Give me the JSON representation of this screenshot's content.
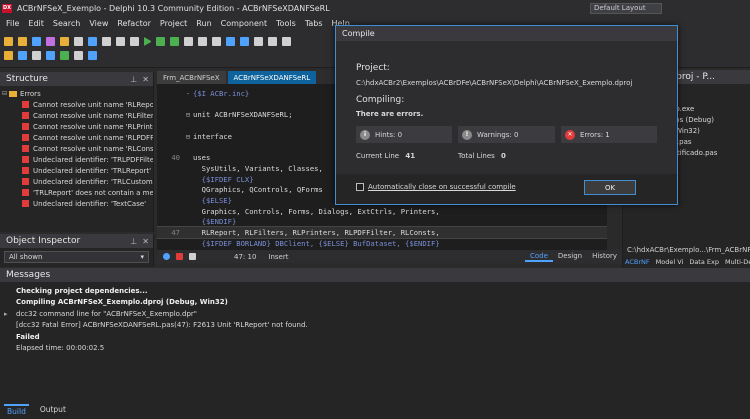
{
  "window": {
    "title": "ACBrNFSeX_Exemplo - Delphi 10.3 Community Edition - ACBrNFSeXDANFSeRL",
    "logo_text": "DX",
    "layout_label": "Default Layout"
  },
  "menu": [
    "File",
    "Edit",
    "Search",
    "View",
    "Refactor",
    "Project",
    "Run",
    "Component",
    "Tools",
    "Tabs",
    "Help"
  ],
  "structure": {
    "title": "Structure",
    "root_label": "Errors",
    "items": [
      "Cannot resolve unit name 'RLReport'",
      "Cannot resolve unit name 'RLFilters'",
      "Cannot resolve unit name 'RLPrinters'",
      "Cannot resolve unit name 'RLPDFFilter'",
      "Cannot resolve unit name 'RLConsts'",
      "Undeclared identifier: 'TRLPDFFilter' at",
      "Undeclared identifier: 'TRLReport' at",
      "Undeclared identifier: 'TRLCustomReport'",
      "'TRLReport' does not contain a member",
      "Undeclared identifier: 'TextCase'"
    ]
  },
  "object_inspector": {
    "title": "Object Inspector",
    "combo_value": "All shown"
  },
  "editor": {
    "tabs": [
      {
        "label": "Frm_ACBrNFSeX",
        "active": false
      },
      {
        "label": "ACBrNFSeXDANFSeRL",
        "active": true
      }
    ],
    "lines": [
      {
        "num": "",
        "fold": "-",
        "text": "{$I ACBr.inc}",
        "kind": "dir"
      },
      {
        "num": "",
        "fold": "",
        "text": "",
        "kind": "code"
      },
      {
        "num": "",
        "fold": "⊟",
        "text": "unit ACBrNFSeXDANFSeRL;",
        "kind": "code"
      },
      {
        "num": "",
        "fold": "",
        "text": "",
        "kind": "code"
      },
      {
        "num": "",
        "fold": "⊟",
        "text": "interface",
        "kind": "code"
      },
      {
        "num": "",
        "fold": "",
        "text": "",
        "kind": "code"
      },
      {
        "num": "40",
        "fold": "",
        "text": "uses",
        "kind": "code"
      },
      {
        "num": "",
        "fold": "",
        "text": "  SysUtils, Variants, Classes, ",
        "kind": "code"
      },
      {
        "num": "",
        "fold": "",
        "text": "  {$IFDEF CLX}",
        "kind": "dir"
      },
      {
        "num": "",
        "fold": "",
        "text": "  QGraphics, QControls, QForms",
        "kind": "code"
      },
      {
        "num": "",
        "fold": "",
        "text": "  {$ELSE}",
        "kind": "dir"
      },
      {
        "num": "",
        "fold": "",
        "text": "  Graphics, Controls, Forms, Dialogs, ExtCtrls, Printers,",
        "kind": "code"
      },
      {
        "num": "",
        "fold": "",
        "text": "  {$ENDIF}",
        "kind": "dir"
      },
      {
        "num": "47",
        "fold": "",
        "text": "  RLReport, RLFilters, RLPrinters, RLPDFFilter, RLConsts,",
        "kind": "code",
        "current": true
      },
      {
        "num": "",
        "fold": "",
        "text": "  {$IFDEF BORLAND} DBClient, {$ELSE} BufDataset, {$ENDIF}",
        "kind": "dir"
      }
    ],
    "status": {
      "position": "47: 10",
      "mode": "Insert",
      "views": [
        {
          "label": "Code",
          "active": true
        },
        {
          "label": "Design",
          "active": false
        },
        {
          "label": "History",
          "active": false
        }
      ]
    }
  },
  "project": {
    "title": "Exemplo.dproj - P...",
    "items": [
      "1",
      "eX_Exemplo.exe",
      "onfigurations (Debug)",
      "Platforms (Win32)",
      "ACBrNFSeX.pas",
      "lecionarCertificado.pas",
      "tus.pas"
    ],
    "path": "C:\\hdxACBr\\Exemplo...\\Frm_ACBrNFSeX",
    "tabs": [
      "ACBrNF",
      "Model Vi",
      "Data Exp",
      "Multi-De"
    ]
  },
  "messages": {
    "title": "Messages",
    "lines": [
      {
        "text": "Checking project dependencies...",
        "bold": true,
        "icon": ""
      },
      {
        "text": "Compiling ACBrNFSeX_Exemplo.dproj (Debug, Win32)",
        "bold": true,
        "icon": ""
      },
      {
        "text": "dcc32 command line for \"ACBrNFSeX_Exemplo.dpr\"",
        "bold": false,
        "icon": "▸"
      },
      {
        "text": "[dcc32 Fatal Error] ACBrNFSeXDANFSeRL.pas(47): F2613 Unit 'RLReport' not found.",
        "bold": false,
        "icon": ""
      },
      {
        "text": "Failed",
        "bold": true,
        "icon": ""
      },
      {
        "text": "Elapsed time: 00:00:02.5",
        "bold": false,
        "icon": ""
      }
    ],
    "tabs": [
      {
        "label": "Build",
        "active": true
      },
      {
        "label": "Output",
        "active": false
      }
    ]
  },
  "dialog": {
    "title": "Compile",
    "project_label": "Project:",
    "project_path": "C:\\hdxACBr2\\Exemplos\\ACBrDFe\\ACBrNFSeX\\Delphi\\ACBrNFSeX_Exemplo.dproj",
    "compiling_label": "Compiling:",
    "status_text": "There are errors.",
    "hints": "Hints: 0",
    "warnings": "Warnings: 0",
    "errors": "Errors: 1",
    "current_line_label": "Current Line",
    "current_line_value": "41",
    "total_lines_label": "Total Lines",
    "total_lines_value": "0",
    "auto_close_label": "Automatically close on successful compile",
    "ok_label": "OK"
  },
  "colors": {
    "accent": "#3f8fd2",
    "error": "#e23b3b",
    "background": "#2b2b2b"
  }
}
